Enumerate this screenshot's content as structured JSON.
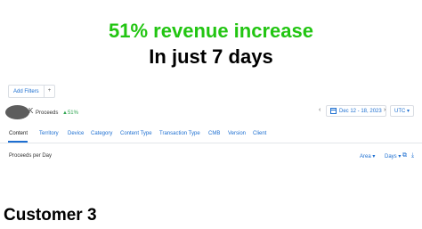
{
  "headline": {
    "line1": "51% revenue increase",
    "line2": "In just 7 days"
  },
  "filters": {
    "add_label": "Add Filters",
    "plus": "+"
  },
  "metric": {
    "k_letter": "K",
    "label": "Proceeds",
    "delta": "▲51%"
  },
  "date": {
    "prev": "‹",
    "range": "Dec 12 - 18, 2023",
    "next": "›"
  },
  "timezone": "UTC ▾",
  "tabs": [
    "Content",
    "Territory",
    "Device",
    "Category",
    "Content Type",
    "Transaction Type",
    "CMB",
    "Version",
    "Client"
  ],
  "chart": {
    "title": "Proceeds per Day",
    "area_ctrl": "Area ▾",
    "days_ctrl": "Days ▾",
    "bookmark_icon": "⧉",
    "download_icon": "⤓"
  },
  "caption": "Customer 3",
  "colors": {
    "accent": "#1d6fd1",
    "success": "#22c512"
  }
}
